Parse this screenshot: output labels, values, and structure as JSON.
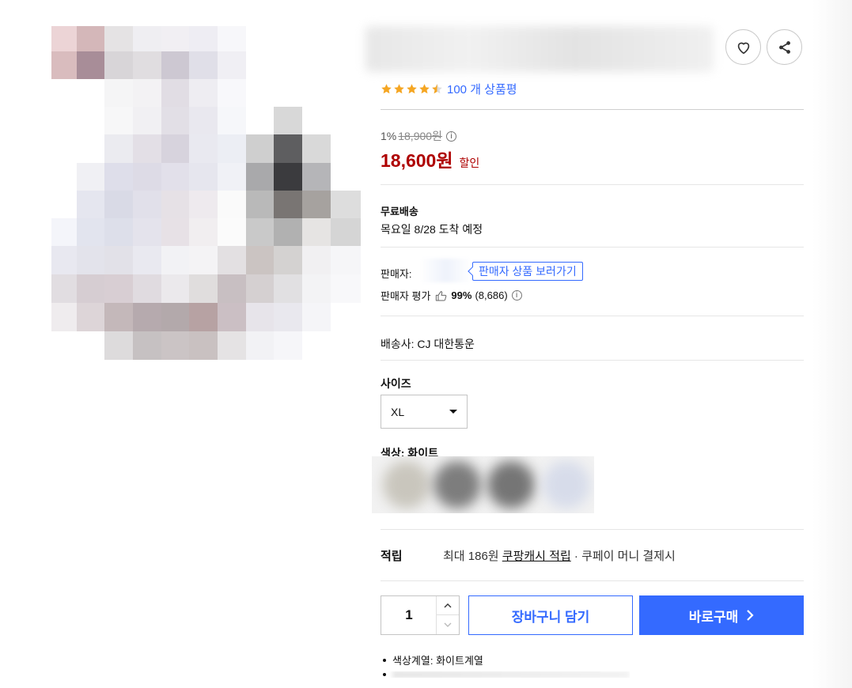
{
  "header": {
    "rating_stars": 4.5,
    "review_count_text": "100 개 상품평"
  },
  "price": {
    "discount_rate": "1%",
    "original_price": "18,900원",
    "sale_price": "18,600원",
    "sale_label": "할인"
  },
  "delivery": {
    "title": "무료배송",
    "eta": "목요일 8/28 도착 예정"
  },
  "seller": {
    "label": "판매자:",
    "link_text": "판매자 상품 보러가기",
    "rating_label": "판매자 평가",
    "rating_percent": "99%",
    "rating_count": "(8,686)"
  },
  "shipping": {
    "carrier_text": "배송사: CJ 대한통운"
  },
  "options": {
    "size_label": "사이즈",
    "size_selected": "XL",
    "color_label": "색상: 화이트"
  },
  "reward": {
    "label": "적립",
    "prefix": "최대 186원",
    "link": "쿠팡캐시 적립",
    "suffix": "· 쿠페이 머니 결제시"
  },
  "purchase": {
    "quantity": "1",
    "cart_label": "장바구니 담기",
    "buy_label": "바로구매"
  },
  "attributes": [
    "색상계열: 화이트계열"
  ],
  "icons": {
    "wishlist": "heart-icon",
    "share": "share-icon",
    "info": "info-icon",
    "thumbs_up": "thumbs-up-icon",
    "chevron_right": "chevron-right-icon",
    "qty_up": "chevron-up-icon",
    "qty_down": "chevron-down-icon"
  },
  "colors": {
    "accent": "#346aff",
    "price_red": "#ae0000",
    "star": "#f5a623"
  }
}
